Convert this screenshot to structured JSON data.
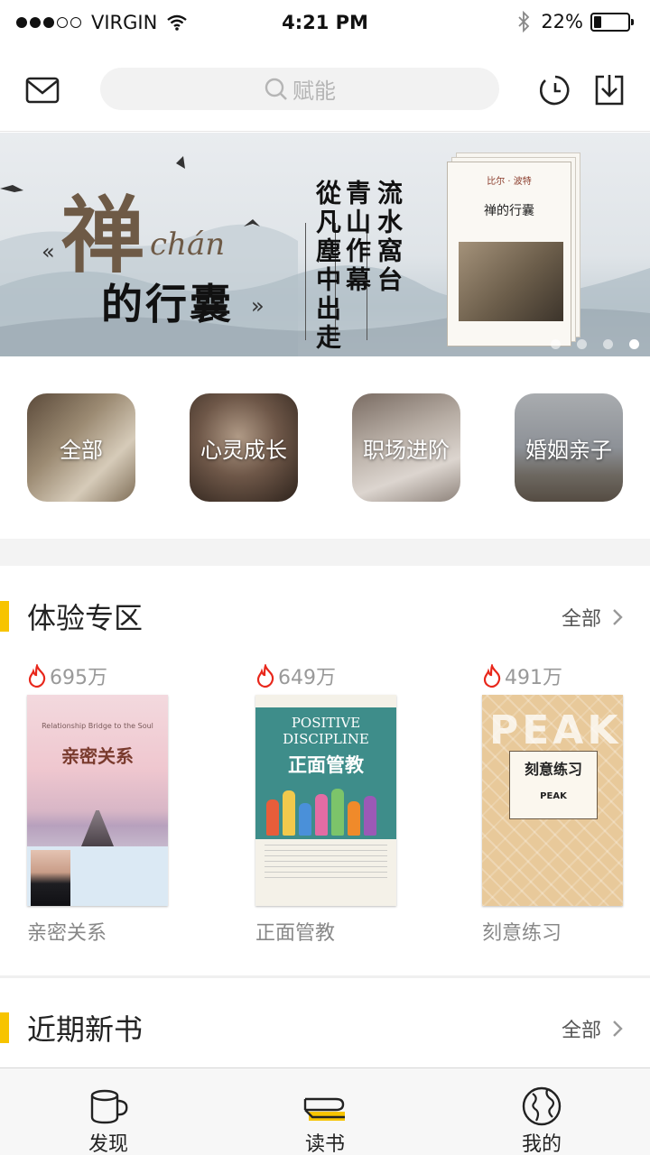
{
  "status_bar": {
    "carrier": "VIRGIN",
    "time": "4:21 PM",
    "battery": "22%",
    "battery_level": 0.22,
    "signal_bars_filled": 3,
    "signal_bars_total": 5
  },
  "top_bar": {
    "search_placeholder": "赋能",
    "icons": [
      "mail-icon",
      "search-icon",
      "history-clock-icon",
      "download-icon"
    ]
  },
  "banner": {
    "title_main": "禅",
    "title_latin": "chán",
    "title_sub": "的行囊",
    "quote_left": "«",
    "quote_right": "»",
    "vertical_lines": [
      "流水窩台",
      "青山作幕",
      "從凡塵中出走"
    ],
    "book_author": "比尔 · 波特",
    "book_title": "禅的行囊",
    "pages_total": 4,
    "active_page": 4
  },
  "categories": [
    {
      "label": "全部"
    },
    {
      "label": "心灵成长"
    },
    {
      "label": "职场进阶"
    },
    {
      "label": "婚姻亲子"
    }
  ],
  "section_trial": {
    "title": "体验专区",
    "more": "全部",
    "books": [
      {
        "heat": "695万",
        "title": "亲密关系",
        "cover_title": "亲密关系",
        "cover_sub": "Relationship Bridge to the Soul"
      },
      {
        "heat": "649万",
        "title": "正面管教",
        "cover_title": "正面管教",
        "cover_en": "POSITIVE DISCIPLINE"
      },
      {
        "heat": "491万",
        "title": "刻意练习",
        "cover_title": "刻意练习",
        "cover_en": "PEAK"
      }
    ]
  },
  "section_new": {
    "title": "近期新书",
    "more": "全部"
  },
  "tab_bar": {
    "tabs": [
      {
        "label": "发现",
        "icon": "cup-icon"
      },
      {
        "label": "读书",
        "icon": "book-stack-icon"
      },
      {
        "label": "我的",
        "icon": "globe-icon"
      }
    ],
    "active": 1,
    "accent": "#f7c400"
  }
}
